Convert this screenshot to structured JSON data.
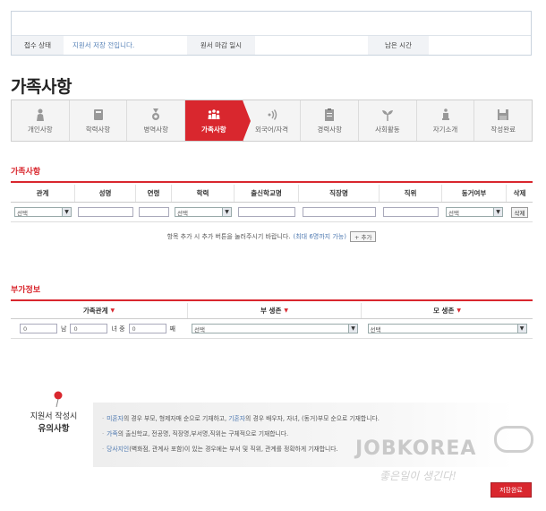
{
  "status": {
    "state_label": "접수 상태",
    "state_value": "지원서 저장 전입니다.",
    "deadline_label": "원서 마감 일시",
    "deadline_value": "",
    "remaining_label": "남은 시간",
    "remaining_value": ""
  },
  "page_title": "가족사항",
  "steps": [
    {
      "label": "개인사항",
      "icon": "person-icon"
    },
    {
      "label": "학력사항",
      "icon": "book-icon"
    },
    {
      "label": "병역사항",
      "icon": "medal-icon"
    },
    {
      "label": "가족사항",
      "icon": "family-icon",
      "active": true
    },
    {
      "label": "외국어/자격",
      "icon": "speech-waves-icon"
    },
    {
      "label": "경력사항",
      "icon": "clipboard-icon"
    },
    {
      "label": "사회활동",
      "icon": "sprout-icon"
    },
    {
      "label": "자기소개",
      "icon": "podium-icon"
    },
    {
      "label": "작성완료",
      "icon": "floppy-disk-icon"
    }
  ],
  "family": {
    "section_title": "가족사항",
    "columns": [
      "관계",
      "성명",
      "연령",
      "학력",
      "출신학교명",
      "직장명",
      "직위",
      "동거여부",
      "삭제"
    ],
    "row": {
      "relation_select": "선택",
      "education_select": "선택",
      "cohabit_select": "선택",
      "delete_label": "삭제"
    },
    "hint": "항목 추가 시 추가 버튼을 눌러주시기 바랍니다.",
    "hint_limit": "(최대 6명까지 가능)",
    "add_label": "+ 추가"
  },
  "extra": {
    "section_title": "부가정보",
    "columns": [
      "가족관계",
      "부 생존",
      "모 생존"
    ],
    "row": {
      "male_value": "0",
      "male_unit": "남",
      "female_value": "0",
      "female_unit": "녀 중",
      "order_value": "0",
      "order_unit": "째",
      "father_select": "선택",
      "mother_select": "선택"
    }
  },
  "notice": {
    "title_line1": "지원서 작성시",
    "title_line2": "유의사항",
    "line1_hl1": "미혼자",
    "line1_mid": "의 경우 부모, 형제자매 순으로 기재하고, ",
    "line1_hl2": "기혼자",
    "line1_end": "의 경우 배우자, 자녀, (동거)부모 순으로 기재합니다.",
    "line2_hl": "가족",
    "line2_end": "의 출신학교, 전공명, 직장명,부서명,직위는 구체적으로 기재합니다.",
    "line3_hl": "당사지인",
    "line3_end": "(벽화점, 관계사 포함)이 있는 경우에는 부서 및 직위, 관계를 정확하게 기재합니다."
  },
  "brand": {
    "logo_text": "JOBKOREA",
    "slogan": "좋은일이 생긴다!"
  },
  "finish_label": "저장완료",
  "colors": {
    "accent": "#d9272e",
    "link": "#4d78b0"
  }
}
